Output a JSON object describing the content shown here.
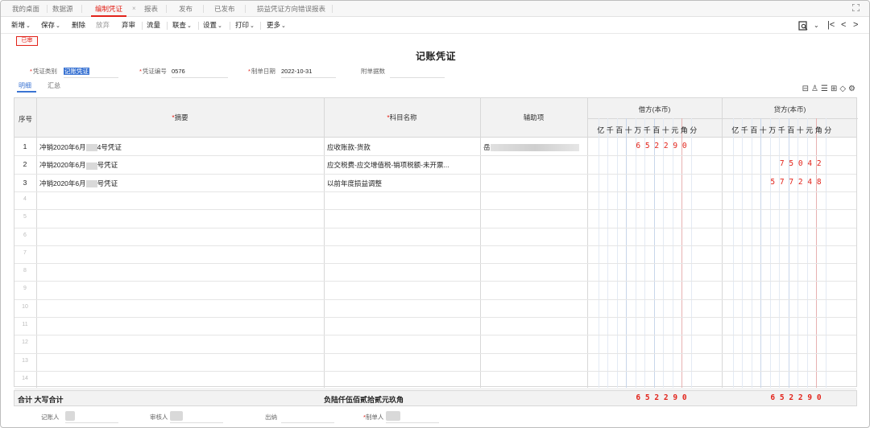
{
  "tabs": [
    {
      "label": "我的桌面",
      "active": false
    },
    {
      "label": "数据源",
      "active": false
    },
    {
      "label": "编制凭证",
      "active": true
    },
    {
      "label": "报表",
      "active": false
    },
    {
      "label": "发布",
      "active": false
    },
    {
      "label": "已发布",
      "active": false
    },
    {
      "label": "损益凭证方向错误报表",
      "active": false
    }
  ],
  "tab_close": "×",
  "toolbar": {
    "new": "新增",
    "save": "保存",
    "delete": "删除",
    "abandon": "放弃",
    "unaudit": "弃审",
    "flow": "流量",
    "linked": "联查",
    "settings": "设置",
    "print": "打印",
    "more": "更多"
  },
  "toolbar_right": {
    "first": "|<",
    "prev": "<",
    "next": ">"
  },
  "status_stamp": "已审",
  "title": "记账凭证",
  "fields": {
    "voucher_type_label": "凭证类别",
    "voucher_type_value": "记账凭证",
    "voucher_no_label": "凭证编号",
    "voucher_no_value": "0576",
    "date_label": "制单日期",
    "date_value": "2022-10-31",
    "attach_label": "附单据数",
    "attach_value": ""
  },
  "subtabs": [
    "明细",
    "汇总"
  ],
  "columns": {
    "seq": "序号",
    "summary": "摘要",
    "account": "科目名称",
    "aux": "辅助项",
    "debit": "借方(本币)",
    "credit": "贷方(本币)"
  },
  "digit_labels": [
    "亿",
    "千",
    "百",
    "十",
    "万",
    "千",
    "百",
    "十",
    "元",
    "角",
    "分"
  ],
  "rows": [
    {
      "seq": "1",
      "summary_a": "冲销2020年6月",
      "summary_b": "4号凭证",
      "account": "应收账款-货款",
      "aux": "岳",
      "debit": "652290",
      "credit": ""
    },
    {
      "seq": "2",
      "summary_a": "冲销2020年6月",
      "summary_b": "号凭证",
      "account": "应交税费-应交增值税-销项税额-未开票...",
      "aux": "",
      "debit": "",
      "credit": "75042"
    },
    {
      "seq": "3",
      "summary_a": "冲销2020年6月",
      "summary_b": "号凭证",
      "account": "以前年度损益调整",
      "aux": "",
      "debit": "",
      "credit": "577248"
    }
  ],
  "empty_rows": [
    "4",
    "5",
    "6",
    "7",
    "8",
    "9",
    "10",
    "11",
    "12",
    "13",
    "14"
  ],
  "total": {
    "label": "合计 大写合计",
    "words": "负陆仟伍佰贰拾贰元玖角",
    "debit": "652290",
    "credit": "652290"
  },
  "footer": {
    "bookkeeper": "记账人",
    "auditor": "审核人",
    "cashier": "出纳",
    "maker": "制单人"
  },
  "colors": {
    "accent_red": "#e2231a",
    "accent_blue": "#3b74d3",
    "header_bg": "#f2f2f2"
  }
}
